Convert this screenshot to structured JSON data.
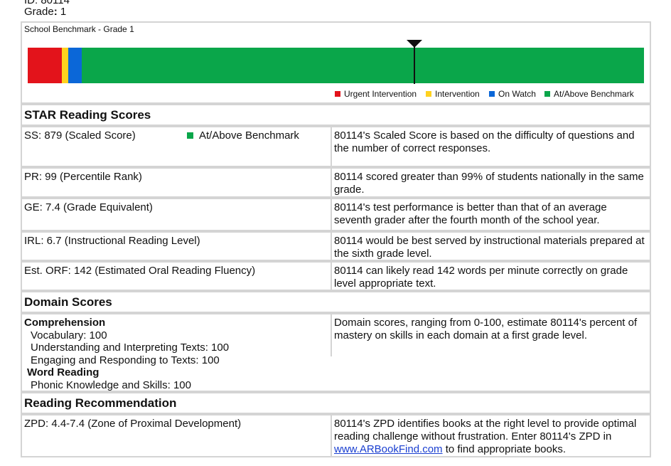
{
  "header": {
    "id_text": "ID: 80114",
    "grade_label": "Grade",
    "grade_value": "1"
  },
  "benchmark": {
    "title": "School Benchmark - Grade 1",
    "segments": [
      {
        "label": "Urgent Intervention",
        "color": "#e3131b"
      },
      {
        "label": "Intervention",
        "color": "#ffd21f"
      },
      {
        "label": "On Watch",
        "color": "#0b67d8"
      },
      {
        "label": "At/Above Benchmark",
        "color": "#0aa64a"
      }
    ]
  },
  "star_scores": {
    "heading": "STAR Reading Scores",
    "rows": [
      {
        "left": "SS: 879 (Scaled Score)",
        "status": "At/Above Benchmark",
        "right": "80114's Scaled Score is based on the difficulty of questions and the number of correct responses."
      },
      {
        "left": "PR: 99 (Percentile Rank)",
        "right": "80114 scored greater than 99% of students nationally in the same grade."
      },
      {
        "left": "GE: 7.4 (Grade Equivalent)",
        "right": "80114's test performance is better than that of an average seventh grader after the fourth month of the school year."
      },
      {
        "left": "IRL: 6.7 (Instructional Reading Level)",
        "right": "80114 would be best served by instructional materials prepared at the sixth grade level."
      },
      {
        "left": "Est. ORF: 142 (Estimated Oral Reading Fluency)",
        "right": "80114 can likely read 142 words per minute correctly on grade level appropriate text."
      }
    ]
  },
  "domain_scores": {
    "heading": "Domain Scores",
    "comprehension_label": "Comprehension",
    "vocabulary": "Vocabulary: 100",
    "understanding": "Understanding and Interpreting Texts: 100",
    "engaging": "Engaging and Responding to Texts: 100",
    "word_reading_label": "Word Reading",
    "phonic": "Phonic Knowledge and Skills: 100",
    "description": "Domain scores, ranging from 0-100, estimate 80114's percent of mastery on skills in each domain at a first grade level."
  },
  "recommendation": {
    "heading": "Reading Recommendation",
    "zpd": "ZPD: 4.4-7.4 (Zone of Proximal Development)",
    "text_before": "80114's ZPD identifies books at the right level to provide optimal reading challenge without frustration. Enter 80114's ZPD in",
    "link": "www.ARBookFind.com",
    "text_after": "to find appropriate books."
  }
}
